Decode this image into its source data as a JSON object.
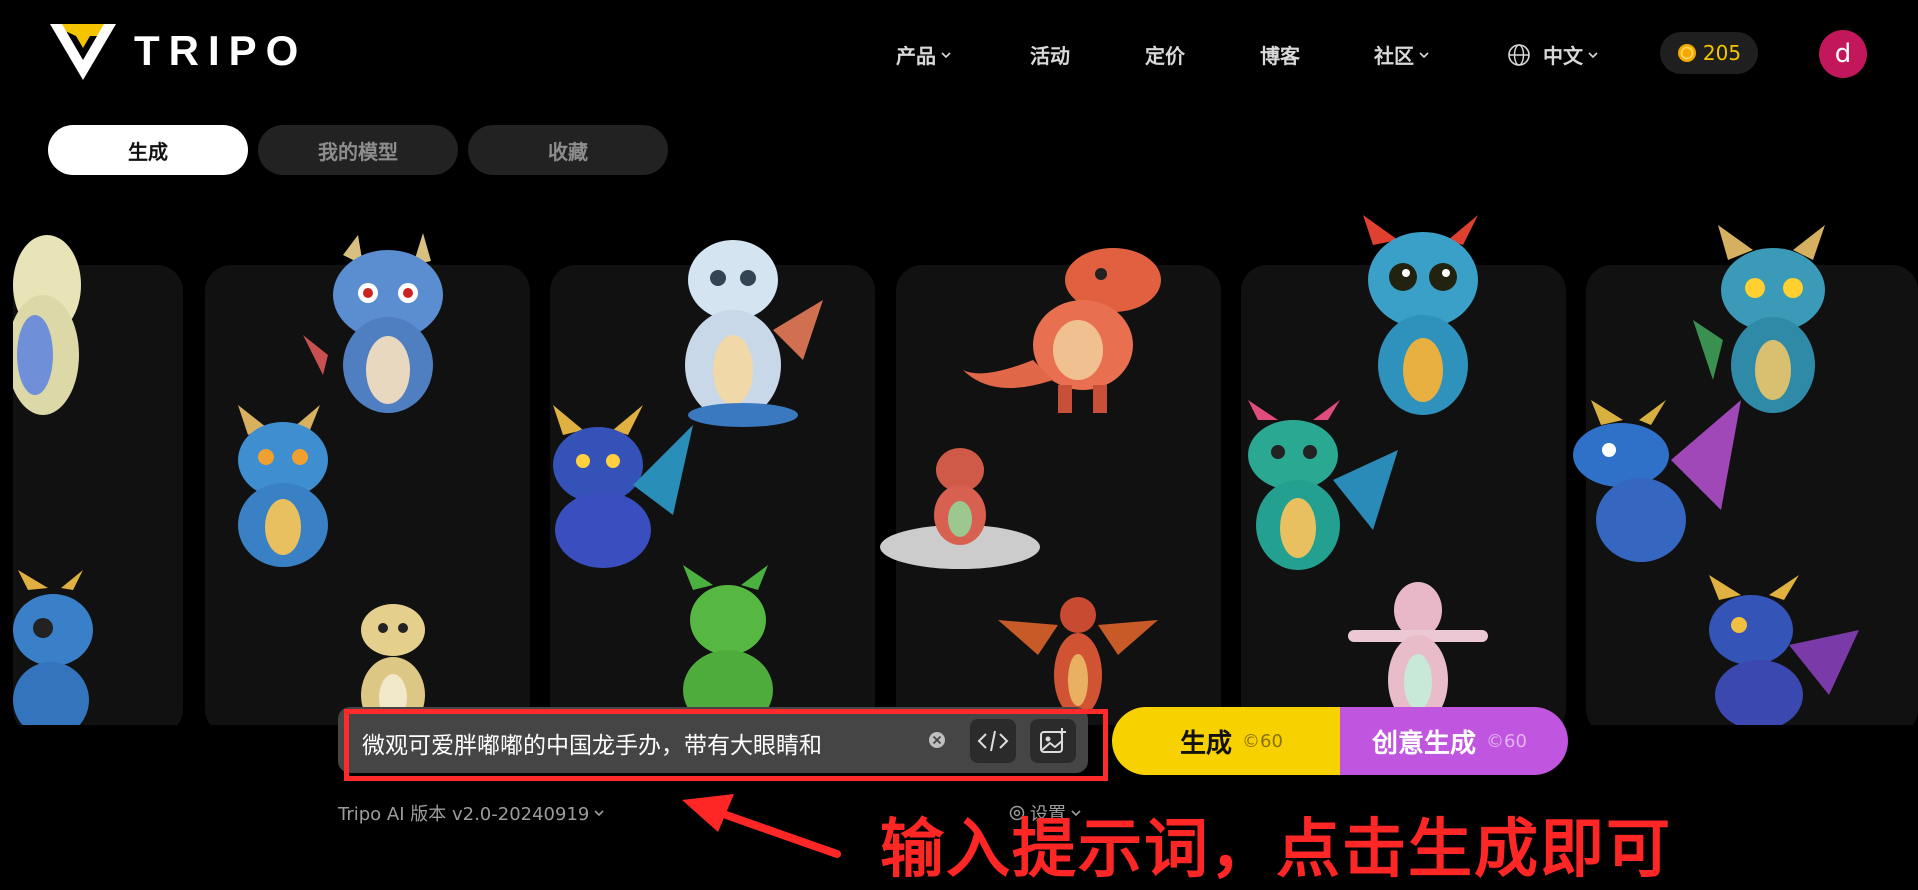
{
  "header": {
    "logo_text": "TRIPO",
    "nav": [
      {
        "label": "产品",
        "dropdown": true
      },
      {
        "label": "活动",
        "dropdown": false
      },
      {
        "label": "定价",
        "dropdown": false
      },
      {
        "label": "博客",
        "dropdown": false
      },
      {
        "label": "社区",
        "dropdown": true
      },
      {
        "label": "中文",
        "dropdown": true,
        "icon": "globe-icon"
      }
    ],
    "credits": "205",
    "avatar_letter": "d"
  },
  "tabs": [
    {
      "label": "生成",
      "active": true
    },
    {
      "label": "我的模型",
      "active": false
    },
    {
      "label": "收藏",
      "active": false
    }
  ],
  "prompt": {
    "value": "微观可爱胖嘟嘟的中国龙手办，带有大眼睛和"
  },
  "buttons": {
    "generate_label": "生成",
    "generate_cost": "©60",
    "creative_label": "创意生成",
    "creative_cost": "©60"
  },
  "footer": {
    "version": "Tripo AI 版本 v2.0-20240919",
    "settings": "设置"
  },
  "annotation": "输入提示词，点击生成即可",
  "colors": {
    "accent_yellow": "#f7d200",
    "accent_purple": "#c055e0",
    "avatar": "#c3175c",
    "annotation_red": "#ff2626"
  }
}
